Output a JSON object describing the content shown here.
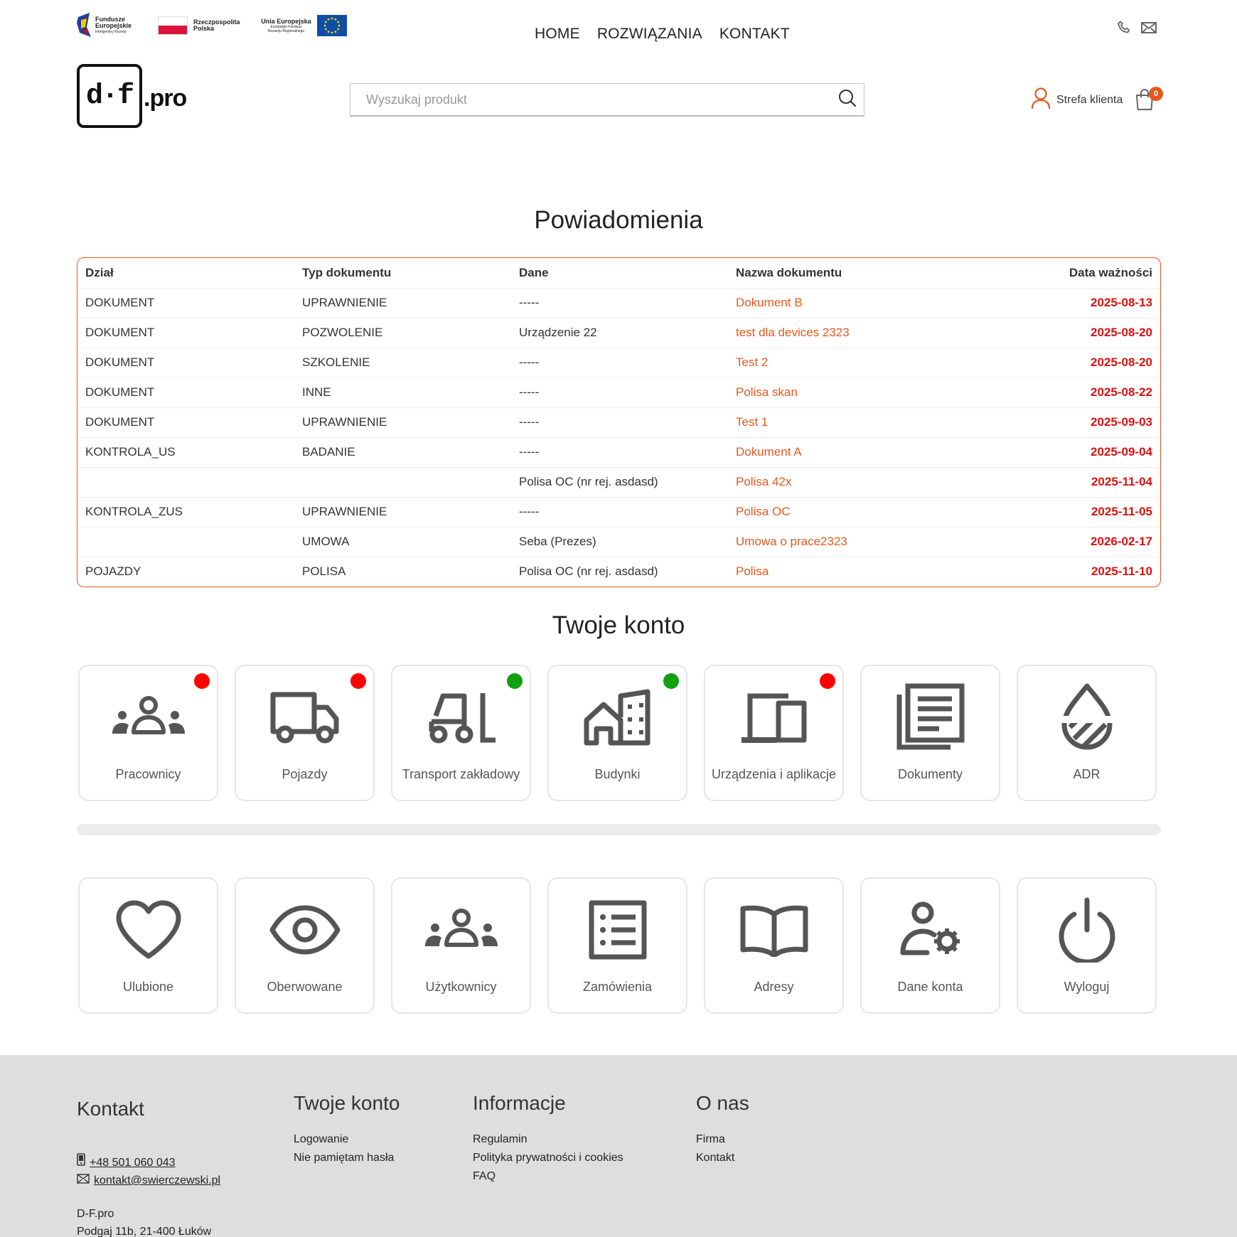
{
  "eu_logos": {
    "fe_line1": "Fundusze",
    "fe_line2": "Europejskie",
    "fe_sub": "Inteligentny Rozwój",
    "pl_line1": "Rzeczpospolita",
    "pl_line2": "Polska",
    "ue_line1": "Unia Europejska",
    "ue_sub1": "Europejski Fundusz",
    "ue_sub2": "Rozwoju Regionalnego"
  },
  "nav": [
    {
      "label": "HOME"
    },
    {
      "label": "ROZWIĄZANIA"
    },
    {
      "label": "KONTAKT"
    }
  ],
  "logo": {
    "mark": "d·f",
    "suffix": ".pro"
  },
  "search": {
    "placeholder": "Wyszukaj produkt"
  },
  "client": {
    "label": "Strefa klienta",
    "cart_count": "0"
  },
  "notifications": {
    "title": "Powiadomienia",
    "headers": [
      "Dział",
      "Typ dokumentu",
      "Dane",
      "Nazwa dokumentu",
      "Data ważności"
    ],
    "rows": [
      {
        "dzial": "DOKUMENT",
        "typ": "UPRAWNIENIE",
        "dane": "-----",
        "nazwa": "Dokument B",
        "data": "2025-08-13"
      },
      {
        "dzial": "DOKUMENT",
        "typ": "POZWOLENIE",
        "dane": "Urządzenie 22",
        "nazwa": "test dla devices 2323",
        "data": "2025-08-20"
      },
      {
        "dzial": "DOKUMENT",
        "typ": "SZKOLENIE",
        "dane": "-----",
        "nazwa": "Test 2",
        "data": "2025-08-20"
      },
      {
        "dzial": "DOKUMENT",
        "typ": "INNE",
        "dane": "-----",
        "nazwa": "Polisa skan",
        "data": "2025-08-22"
      },
      {
        "dzial": "DOKUMENT",
        "typ": "UPRAWNIENIE",
        "dane": "-----",
        "nazwa": "Test 1",
        "data": "2025-09-03"
      },
      {
        "dzial": "KONTROLA_US",
        "typ": "BADANIE",
        "dane": "-----",
        "nazwa": "Dokument A",
        "data": "2025-09-04"
      },
      {
        "dzial": "",
        "typ": "",
        "dane": "Polisa OC (nr rej. asdasd)",
        "nazwa": "Polisa 42x",
        "data": "2025-11-04"
      },
      {
        "dzial": "KONTROLA_ZUS",
        "typ": "UPRAWNIENIE",
        "dane": "-----",
        "nazwa": "Polisa OC",
        "data": "2025-11-05"
      },
      {
        "dzial": "",
        "typ": "UMOWA",
        "dane": "Seba (Prezes)",
        "nazwa": "Umowa o prace2323",
        "data": "2026-02-17"
      },
      {
        "dzial": "POJAZDY",
        "typ": "POLISA",
        "dane": "Polisa OC (nr rej. asdasd)",
        "nazwa": "Polisa",
        "data": "2025-11-10"
      }
    ]
  },
  "account": {
    "title": "Twoje konto",
    "row1": [
      {
        "label": "Pracownicy",
        "icon": "group-icon",
        "status": "red"
      },
      {
        "label": "Pojazdy",
        "icon": "truck-icon",
        "status": "red"
      },
      {
        "label": "Transport zakładowy",
        "icon": "forklift-icon",
        "status": "green"
      },
      {
        "label": "Budynki",
        "icon": "buildings-icon",
        "status": "green"
      },
      {
        "label": "Urządzenia i aplikacje",
        "icon": "devices-icon",
        "status": "red"
      },
      {
        "label": "Dokumenty",
        "icon": "documents-icon",
        "status": "none"
      },
      {
        "label": "ADR",
        "icon": "hazard-drop-icon",
        "status": "none"
      }
    ],
    "progress": 0,
    "row2": [
      {
        "label": "Ulubione",
        "icon": "heart-icon"
      },
      {
        "label": "Oberwowane",
        "icon": "eye-icon"
      },
      {
        "label": "Użytkownicy",
        "icon": "group-icon"
      },
      {
        "label": "Zamówienia",
        "icon": "list-icon"
      },
      {
        "label": "Adresy",
        "icon": "book-icon"
      },
      {
        "label": "Dane konta",
        "icon": "user-settings-icon"
      },
      {
        "label": "Wyloguj",
        "icon": "power-icon"
      }
    ]
  },
  "footer": {
    "kontakt": {
      "title": "Kontakt",
      "phone": "+48 501 060 043",
      "email": "kontakt@swierczewski.pl",
      "company": "D-F.pro",
      "address": "Podgaj 11b, 21-400 Łuków"
    },
    "konto": {
      "title": "Twoje konto",
      "links": [
        "Logowanie",
        "Nie pamiętam hasła"
      ]
    },
    "informacje": {
      "title": "Informacje",
      "links": [
        "Regulamin",
        "Polityka prywatności i cookies",
        "FAQ"
      ]
    },
    "onas": {
      "title": "O nas",
      "links": [
        "Firma",
        "Kontakt"
      ]
    }
  },
  "colors": {
    "accent": "#e5581d",
    "date": "#dd1010",
    "status_red": "#ff0000",
    "status_green": "#10a010",
    "icon": "#555555"
  }
}
